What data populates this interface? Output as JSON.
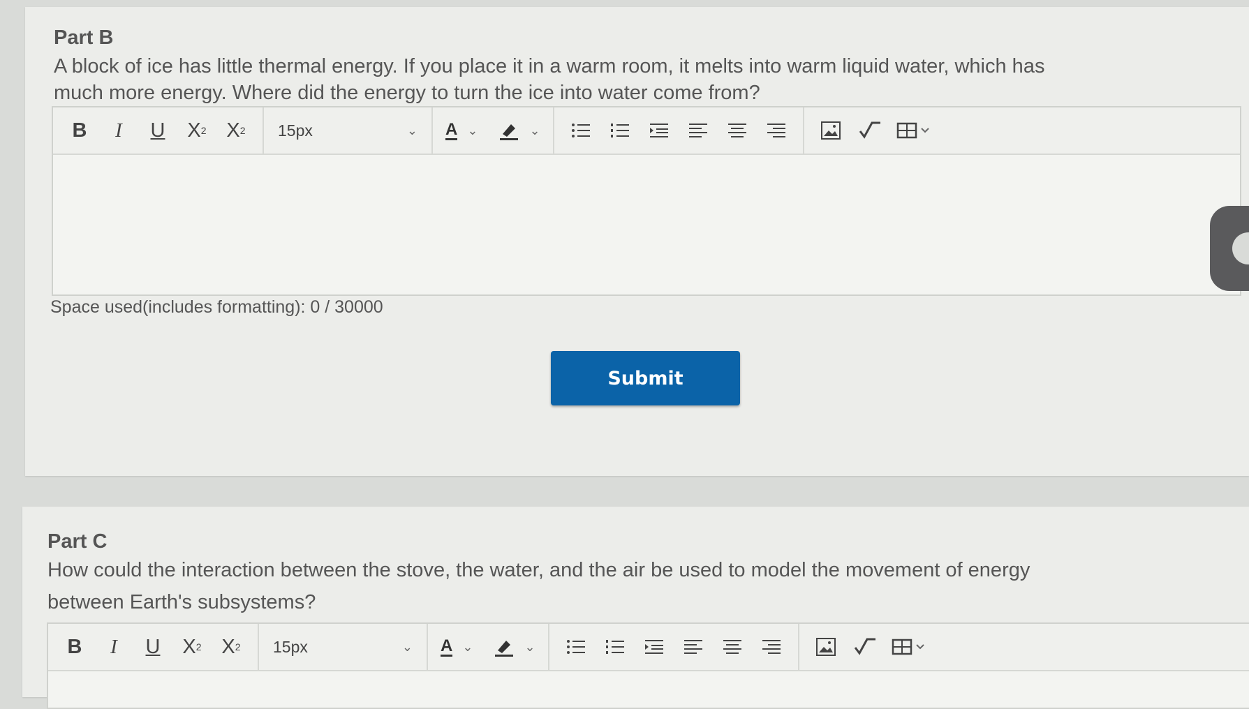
{
  "part_b": {
    "title": "Part B",
    "question_line1": "A block of ice has little thermal energy. If you place it in a warm room, it melts into warm liquid water, which has",
    "question_line2": "much more energy. Where did the energy to turn the ice into water come from?",
    "toolbar": {
      "bold": "B",
      "italic": "I",
      "underline": "U",
      "superscript": "X",
      "superscript_mark": "2",
      "subscript": "X",
      "subscript_mark": "2",
      "font_size": "15px",
      "font_color_label": "A"
    },
    "counter": "Space used(includes formatting): 0 / 30000",
    "submit_label": "Submit"
  },
  "part_c": {
    "title": "Part C",
    "question_line1": "How could the interaction between the stove, the water, and the air be used to model the movement of energy",
    "question_line2": "between Earth's subsystems?",
    "toolbar": {
      "bold": "B",
      "italic": "I",
      "underline": "U",
      "superscript": "X",
      "superscript_mark": "2",
      "subscript": "X",
      "subscript_mark": "2",
      "font_size": "15px",
      "font_color_label": "A"
    }
  },
  "colors": {
    "submit_bg": "#0b63a8",
    "page_bg": "#d9dbd8",
    "panel_bg": "#ecedea"
  },
  "icons": [
    "chevron-down-icon",
    "highlighter-icon",
    "bullet-list-icon",
    "numbered-list-icon",
    "indent-icon",
    "align-left-icon",
    "align-center-icon",
    "align-right-icon",
    "image-icon",
    "math-formula-icon",
    "table-icon"
  ]
}
